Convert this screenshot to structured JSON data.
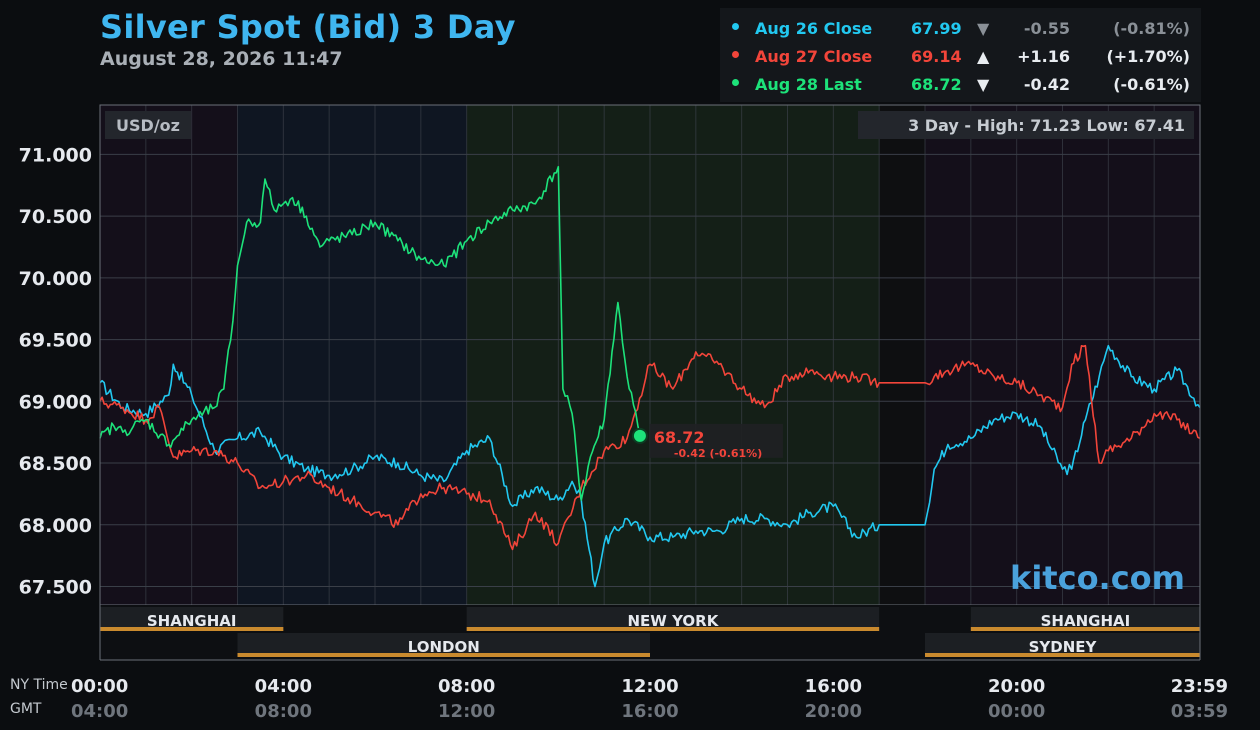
{
  "header": {
    "title": "Silver Spot (Bid) 3 Day",
    "timestamp": "August 28, 2026 11:47"
  },
  "legend": [
    {
      "label": "Aug 26 Close",
      "value": "67.99",
      "arrow": "▼",
      "change": "-0.55",
      "pct": "(-0.81%)",
      "color": "#22c8f0",
      "text_color": "#22c8f0",
      "muted": true
    },
    {
      "label": "Aug 27 Close",
      "value": "69.14",
      "arrow": "▲",
      "change": "+1.16",
      "pct": "(+1.70%)",
      "color": "#f2453a",
      "text_color": "#f2453a",
      "muted": false
    },
    {
      "label": "Aug 28 Last",
      "value": "68.72",
      "arrow": "▼",
      "change": "-0.42",
      "pct": "(-0.61%)",
      "color": "#1de27a",
      "text_color": "#1de27a",
      "muted": false
    }
  ],
  "unit_label": "USD/oz",
  "range_box": "3 Day - High: 71.23  Low: 67.41",
  "watermark": "kitco.com",
  "current_marker": {
    "price": "68.72",
    "change": "-0.42 (-0.61%)",
    "time_h": 11.78,
    "value": 68.72
  },
  "sessions": [
    {
      "name": "SHANGHAI",
      "start_h": 0,
      "end_h": 4,
      "row": 0
    },
    {
      "name": "NEW YORK",
      "start_h": 8,
      "end_h": 17,
      "row": 0
    },
    {
      "name": "SHANGHAI",
      "start_h": 19,
      "end_h": 24,
      "row": 0
    },
    {
      "name": "LONDON",
      "start_h": 3,
      "end_h": 12,
      "row": 1
    },
    {
      "name": "SYDNEY",
      "start_h": 18,
      "end_h": 24,
      "row": 1
    }
  ],
  "axis_labels": {
    "ny_time": "NY Time",
    "gmt": "GMT"
  },
  "colors": {
    "aug26": "#22c8f0",
    "aug27": "#f2453a",
    "aug28": "#1de27a",
    "session_bar": "#c98a2e",
    "grid": "#3a3f48"
  },
  "chart_data": {
    "type": "line",
    "title": "Silver Spot (Bid) 3 Day",
    "ylabel": "USD/oz",
    "ylim": [
      67.35,
      71.4
    ],
    "xlim": [
      0,
      24
    ],
    "grid": true,
    "legend_position": "top-right",
    "y_ticks": [
      "67.500",
      "68.000",
      "68.500",
      "69.000",
      "69.500",
      "70.000",
      "70.500",
      "71.000"
    ],
    "y_tick_values": [
      67.5,
      68.0,
      68.5,
      69.0,
      69.5,
      70.0,
      70.5,
      71.0
    ],
    "x_ticks_ny": [
      "00:00",
      "04:00",
      "08:00",
      "12:00",
      "16:00",
      "20:00",
      "23:59"
    ],
    "x_ticks_gmt": [
      "04:00",
      "08:00",
      "12:00",
      "16:00",
      "20:00",
      "00:00",
      "03:59"
    ],
    "x_tick_hours": [
      0,
      4,
      8,
      12,
      16,
      20,
      23.98
    ],
    "series": [
      {
        "name": "Aug 26 Close",
        "color": "#22c8f0",
        "x": [
          0,
          0.5,
          1,
          1.5,
          1.6,
          2,
          2.5,
          3,
          3.5,
          4,
          4.5,
          5,
          5.5,
          6,
          6.5,
          7,
          7.5,
          8,
          8.5,
          9,
          9.5,
          10,
          10.3,
          10.5,
          10.8,
          11,
          11.5,
          12,
          12.5,
          13,
          13.5,
          14,
          14.5,
          15,
          15.5,
          16,
          16.5,
          17,
          18,
          18.2,
          18.5,
          19,
          19.5,
          20,
          20.5,
          21,
          21.2,
          21.5,
          21.8,
          22,
          22.5,
          23,
          23.5,
          24
        ],
        "y": [
          69.15,
          68.95,
          68.9,
          69.05,
          69.3,
          69.05,
          68.6,
          68.7,
          68.75,
          68.55,
          68.45,
          68.4,
          68.45,
          68.55,
          68.5,
          68.4,
          68.35,
          68.6,
          68.7,
          68.15,
          68.3,
          68.2,
          68.35,
          68.2,
          67.5,
          67.85,
          68.05,
          67.9,
          67.9,
          67.95,
          67.95,
          68.05,
          68.05,
          68.0,
          68.1,
          68.15,
          67.9,
          68.0,
          68.0,
          68.45,
          68.65,
          68.7,
          68.85,
          68.9,
          68.8,
          68.45,
          68.45,
          68.85,
          69.2,
          69.45,
          69.2,
          69.1,
          69.25,
          68.95
        ]
      },
      {
        "name": "Aug 27 Close",
        "color": "#f2453a",
        "x": [
          0,
          0.5,
          1,
          1.3,
          1.6,
          2,
          2.5,
          3,
          3.5,
          4,
          4.5,
          5,
          5.5,
          6,
          6.5,
          7,
          7.5,
          8,
          8.5,
          9,
          9.5,
          10,
          10.5,
          11,
          11.5,
          12,
          12.5,
          13,
          13.5,
          14,
          14.5,
          15,
          15.5,
          16,
          16.5,
          17,
          18,
          18.2,
          18.5,
          19,
          19.5,
          20,
          20.5,
          21,
          21.2,
          21.5,
          21.8,
          22,
          22.5,
          23,
          23.5,
          24
        ],
        "y": [
          69.0,
          68.95,
          68.85,
          68.95,
          68.55,
          68.6,
          68.6,
          68.5,
          68.3,
          68.35,
          68.4,
          68.3,
          68.2,
          68.1,
          68.0,
          68.25,
          68.3,
          68.25,
          68.2,
          67.8,
          68.1,
          67.85,
          68.3,
          68.6,
          68.7,
          69.3,
          69.1,
          69.4,
          69.3,
          69.1,
          68.95,
          69.2,
          69.25,
          69.2,
          69.2,
          69.15,
          69.15,
          69.2,
          69.25,
          69.3,
          69.2,
          69.15,
          69.05,
          68.95,
          69.3,
          69.45,
          68.5,
          68.6,
          68.7,
          68.9,
          68.85,
          68.7
        ]
      },
      {
        "name": "Aug 28 Last",
        "color": "#1de27a",
        "x": [
          0,
          0.3,
          0.5,
          1,
          1.5,
          2,
          2.5,
          2.7,
          2.9,
          3.0,
          3.2,
          3.5,
          3.6,
          3.8,
          4.0,
          4.2,
          4.5,
          4.8,
          5.0,
          5.5,
          6.0,
          6.5,
          7.0,
          7.5,
          8.0,
          8.5,
          9.0,
          9.5,
          10.0,
          10.1,
          10.3,
          10.5,
          10.7,
          11.0,
          11.3,
          11.5,
          11.78
        ],
        "y": [
          68.7,
          68.8,
          68.75,
          68.85,
          68.65,
          68.85,
          68.95,
          69.1,
          69.65,
          70.1,
          70.45,
          70.45,
          70.8,
          70.55,
          70.6,
          70.65,
          70.5,
          70.25,
          70.3,
          70.35,
          70.45,
          70.3,
          70.15,
          70.1,
          70.3,
          70.45,
          70.55,
          70.6,
          70.9,
          69.1,
          68.9,
          68.2,
          68.55,
          68.85,
          69.8,
          69.2,
          68.72
        ]
      }
    ]
  }
}
